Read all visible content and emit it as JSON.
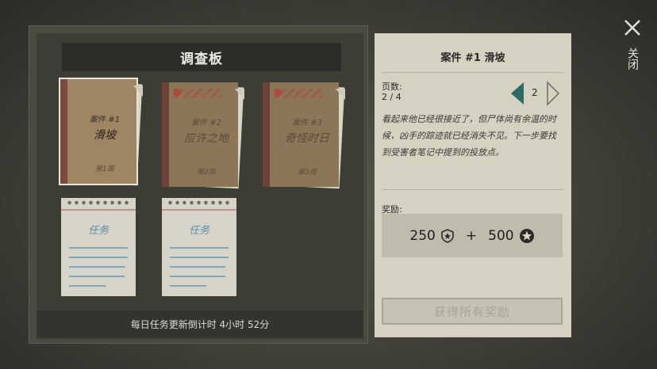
{
  "board": {
    "title": "调查板",
    "cases": [
      {
        "number": "案件 #1",
        "name": "滑坡",
        "week": "第1周"
      },
      {
        "number": "案件 #2",
        "name": "应许之地",
        "week": "第2周"
      },
      {
        "number": "案件 #3",
        "name": "奇怪时日",
        "week": "第3周"
      }
    ],
    "tasks": [
      {
        "label": "任务"
      },
      {
        "label": "任务"
      }
    ],
    "countdown": "每日任务更新倒计时 4小时 52分"
  },
  "detail": {
    "title": "案件 #1 滑坡",
    "pages_label": "页数:",
    "pages_value": "2 / 4",
    "current_page": "2",
    "description": "看起来他已经很接近了，但尸体尚有余温的时候，凶手的踪迹就已经消失不见。下一步要找到受害者笔记中提到的投放点。",
    "reward_label": "奖励:",
    "reward_amount_1": "250",
    "reward_plus": "+",
    "reward_amount_2": "500",
    "reward_icon_1": "shield-badge-icon",
    "reward_icon_2": "star-badge-icon",
    "claim_button": "获得所有奖励"
  },
  "close": {
    "label": "关闭",
    "icon": "close-icon"
  }
}
